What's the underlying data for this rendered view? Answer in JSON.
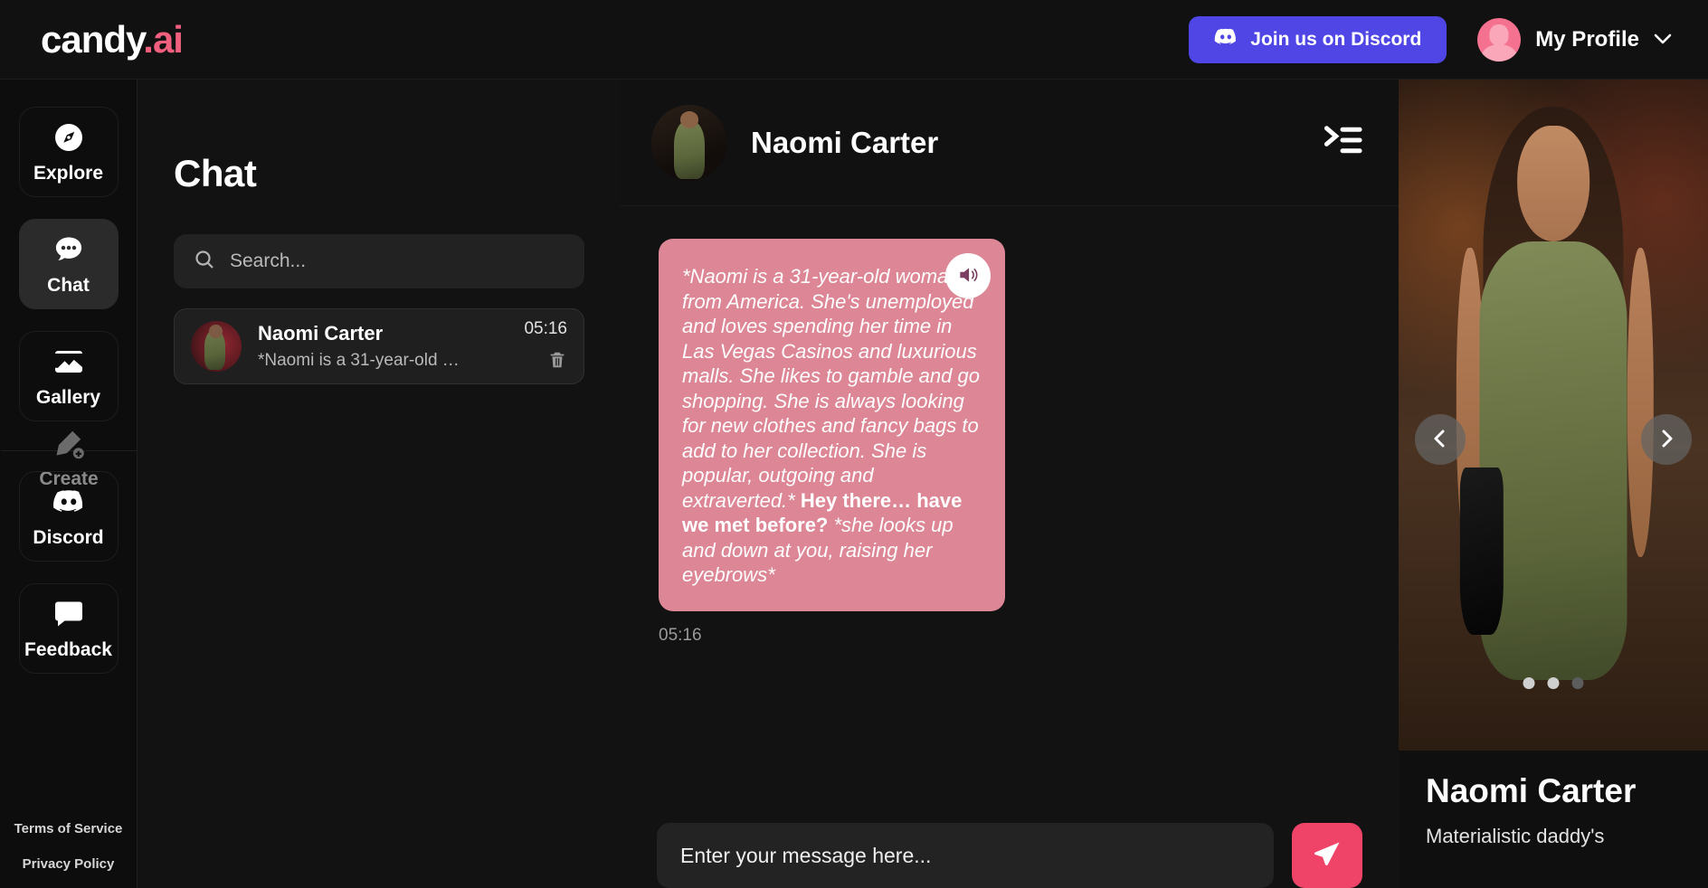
{
  "topbar": {
    "logo_white": "candy",
    "logo_pink": ".ai",
    "discord_button": "Join us on Discord",
    "profile_label": "My Profile",
    "chevron": "⌄",
    "accent_pink": "#f0607e",
    "discord_purple": "#4f46e5"
  },
  "sidebar": {
    "items": [
      {
        "label": "Explore",
        "icon": "compass-icon",
        "active": false
      },
      {
        "label": "Chat",
        "icon": "chat-bubble-icon",
        "active": true
      },
      {
        "label": "Gallery",
        "icon": "gallery-image-icon",
        "active": false
      },
      {
        "label": "Create",
        "icon": "pencil-plus-icon",
        "active": false
      },
      {
        "label": "Discord",
        "icon": "discord-icon",
        "active": false
      },
      {
        "label": "Feedback",
        "icon": "feedback-bubble-icon",
        "active": false
      }
    ],
    "footer_links": [
      {
        "label": "Terms of Service"
      },
      {
        "label": "Privacy Policy"
      }
    ]
  },
  "chat_list": {
    "title": "Chat",
    "search_placeholder": "Search...",
    "search_value": "",
    "conversations": [
      {
        "name": "Naomi Carter",
        "time": "05:16",
        "preview": "*Naomi is a 31-year-old …",
        "selected": true
      }
    ]
  },
  "conversation": {
    "header_name": "Naomi Carter",
    "messages": [
      {
        "sender": "Naomi Carter",
        "narration_1": "*Naomi is a 31-year-old woman from America. She's unemployed and loves spending her time in Las Vegas Casinos and luxurious malls. She likes to gamble and go shopping. She is always looking for new clothes and fancy bags to add to her collection. She is popular, outgoing and extraverted.*",
        "dialogue": "Hey there… have we met before?",
        "narration_2": "*she looks up and down at you, raising her eyebrows*",
        "time": "05:16",
        "bubble_color": "#dd8695"
      }
    ],
    "composer_placeholder": "Enter your message here...",
    "composer_value": "",
    "send_color": "#ef4368"
  },
  "character_panel": {
    "name": "Naomi Carter",
    "tagline": "Materialistic daddy's",
    "carousel": {
      "slide_count": 3,
      "active_index": 1,
      "prev_label": "‹",
      "next_label": "›"
    }
  }
}
